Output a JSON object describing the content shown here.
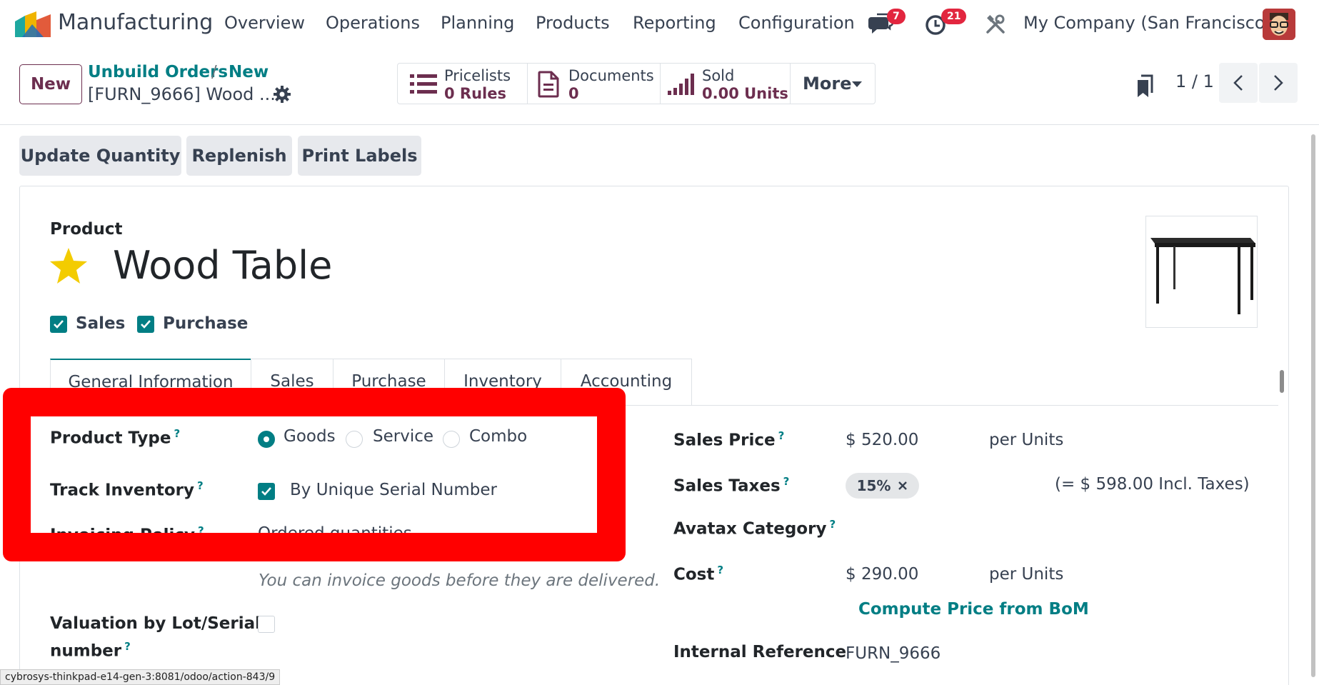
{
  "topnav": {
    "app_name": "Manufacturing",
    "menu": [
      "Overview",
      "Operations",
      "Planning",
      "Products",
      "Reporting",
      "Configuration"
    ],
    "messages_count": "7",
    "activities_count": "21",
    "company": "My Company (San Francisco)"
  },
  "control": {
    "new_label": "New",
    "breadcrumb_parent": "Unbuild Orders",
    "breadcrumb_sep": "/",
    "breadcrumb_current": "New",
    "record_title": "[FURN_9666] Wood ...",
    "smart_buttons": [
      {
        "line1": "Pricelists",
        "line2": "0 Rules"
      },
      {
        "line1": "Documents",
        "line2": "0"
      },
      {
        "line1": "Sold",
        "line2": "0.00 Units"
      }
    ],
    "more_label": "More",
    "pager": "1 / 1"
  },
  "actions": [
    "Update Quantity",
    "Replenish",
    "Print Labels"
  ],
  "form": {
    "product_label": "Product",
    "product_name": "Wood Table",
    "sales_check_label": "Sales",
    "purchase_check_label": "Purchase",
    "tabs": [
      "General Information",
      "Sales",
      "Purchase",
      "Inventory",
      "Accounting"
    ],
    "product_type_label": "Product Type",
    "product_type_options": [
      "Goods",
      "Service",
      "Combo"
    ],
    "track_inventory_label": "Track Inventory",
    "track_inventory_value": "By Unique Serial Number",
    "invoicing_policy_label": "Invoicing Policy",
    "invoicing_policy_value": "Ordered quantities",
    "invoice_hint": "You can invoice goods before they are delivered.",
    "valuation_label_1": "Valuation by Lot/Serial",
    "valuation_label_2": "number",
    "sales_price_label": "Sales Price",
    "sales_price_value": "$ 520.00",
    "sales_price_unit": "per Units",
    "sales_taxes_label": "Sales Taxes",
    "sales_tax_tag": "15%",
    "incl_taxes": "(= $ 598.00 Incl. Taxes)",
    "avatax_label": "Avatax Category",
    "cost_label": "Cost",
    "cost_value": "$ 290.00",
    "cost_unit": "per Units",
    "compute_bom": "Compute Price from BoM",
    "internal_ref_label": "Internal Reference",
    "internal_ref_value": "FURN_9666",
    "help_mark": "?"
  },
  "statusbar": "cybrosys-thinkpad-e14-gen-3:8081/odoo/action-843/9",
  "colors": {
    "accent": "#017e84",
    "brand": "#6c2e4f",
    "highlight": "#ff0000",
    "badge": "#e2263f"
  }
}
